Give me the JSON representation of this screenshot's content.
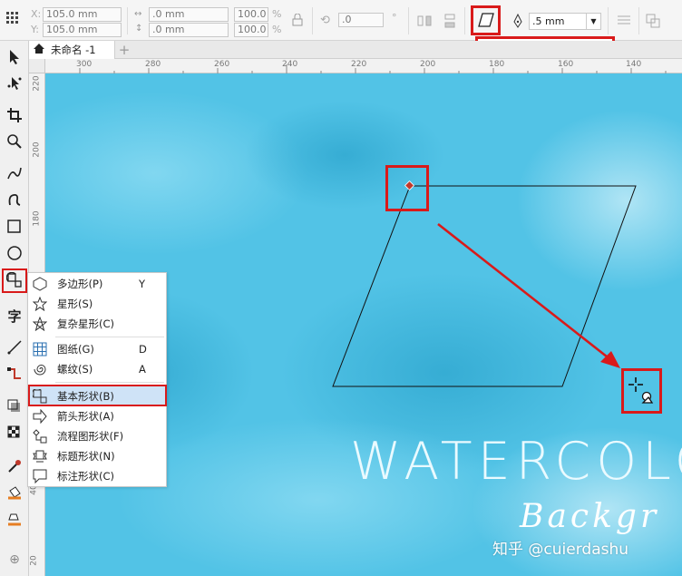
{
  "property_bar": {
    "x_label": "X:",
    "x_value": "105.0 mm",
    "y_label": "Y:",
    "y_value": "105.0 mm",
    "w_value": ".0 mm",
    "h_value": ".0 mm",
    "scale_x": "100.0",
    "scale_y": "100.0",
    "pct": "%",
    "rotation": ".0",
    "degree": "°",
    "outline_width": ".5 mm"
  },
  "document_tab": {
    "title": "未命名 -1",
    "add": "+"
  },
  "ruler": {
    "h_ticks": [
      "300",
      "280",
      "260",
      "240",
      "220",
      "200",
      "180",
      "160",
      "140"
    ],
    "v_ticks": [
      "220",
      "200",
      "180",
      "40",
      "20"
    ]
  },
  "context_menu": {
    "items": [
      {
        "label": "多边形(P)",
        "shortcut": "Y",
        "icon": "polygon-icon"
      },
      {
        "label": "星形(S)",
        "shortcut": "",
        "icon": "star-icon"
      },
      {
        "label": "复杂星形(C)",
        "shortcut": "",
        "icon": "complex-star-icon"
      },
      {
        "label": "图纸(G)",
        "shortcut": "D",
        "icon": "graph-paper-icon"
      },
      {
        "label": "螺纹(S)",
        "shortcut": "A",
        "icon": "spiral-icon"
      },
      {
        "label": "基本形状(B)",
        "shortcut": "",
        "icon": "basic-shapes-icon"
      },
      {
        "label": "箭头形状(A)",
        "shortcut": "",
        "icon": "arrow-shapes-icon"
      },
      {
        "label": "流程图形状(F)",
        "shortcut": "",
        "icon": "flowchart-icon"
      },
      {
        "label": "标题形状(N)",
        "shortcut": "",
        "icon": "banner-icon"
      },
      {
        "label": "标注形状(C)",
        "shortcut": "",
        "icon": "callout-icon"
      }
    ]
  },
  "canvas": {
    "watercolor_text": "WATERCOLO",
    "background_text": "Backgr",
    "watermark": "知乎 @cuierdashu"
  },
  "colors": {
    "highlight_red": "#d91a1a",
    "canvas_blue": "#52c3e6",
    "menu_highlight": "#cfe3f7"
  }
}
